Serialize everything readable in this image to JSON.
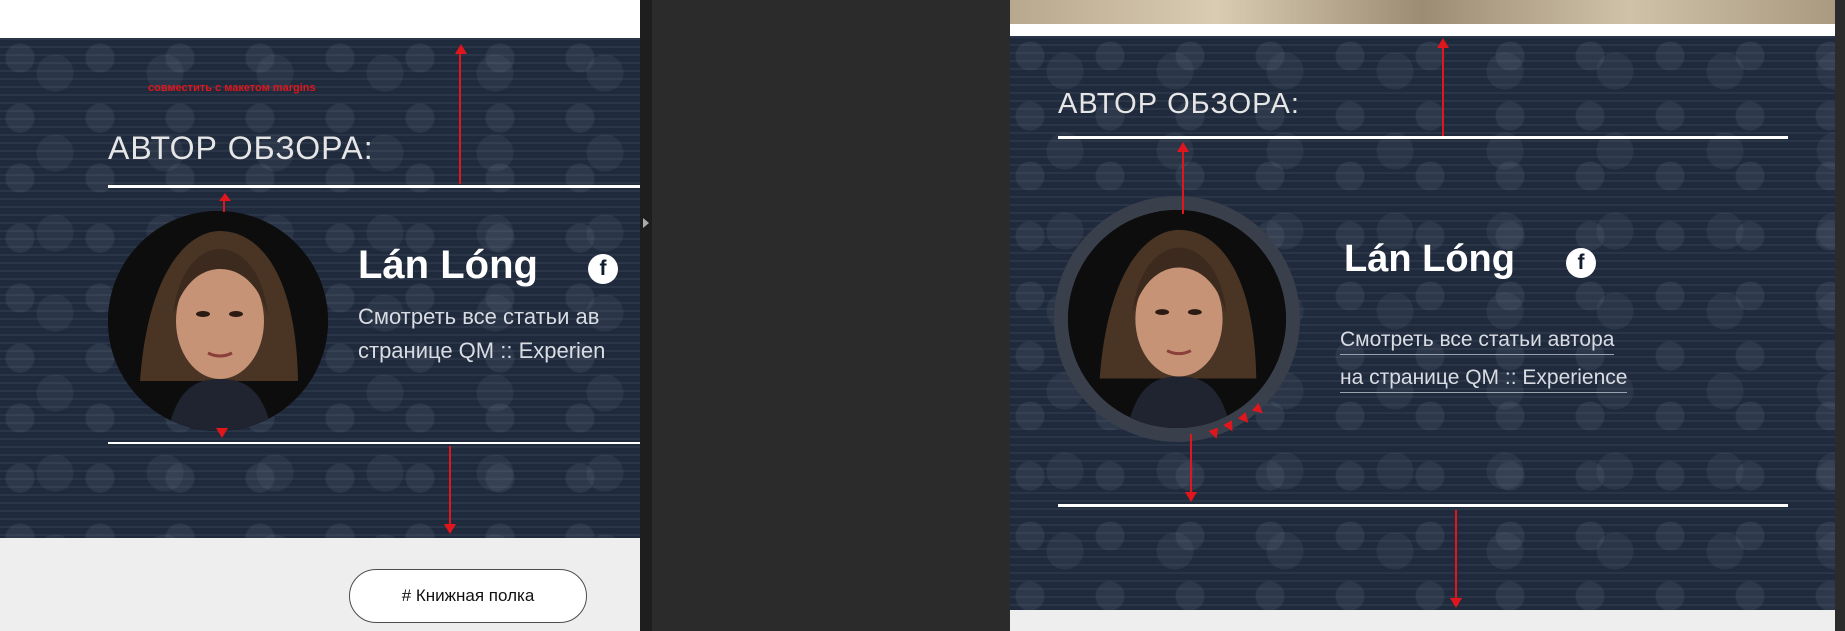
{
  "left_section": {
    "note": "совместить с макетом margins",
    "title": "АВТОР ОБЗОРА:",
    "author_name": "Lán Lóng",
    "link_line1": "Смотреть все статьи ав",
    "link_line2": "странице QM :: Experien",
    "bookshelf_label": "# Книжная полка",
    "facebook_glyph": "f"
  },
  "right_section": {
    "title": "АВТОР ОБЗОРА:",
    "author_name": "Lán Lóng",
    "link_line1": "Смотреть все статьи автора",
    "link_line2": "на странице QM :: Experience",
    "facebook_glyph": "f"
  },
  "colors": {
    "accent_red": "#e0161c",
    "background_blue": "#1f2a3d",
    "page_gray": "#eeeeee",
    "editor_dark": "#2b2b2b"
  }
}
